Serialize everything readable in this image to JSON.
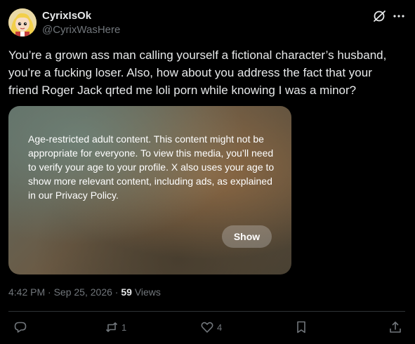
{
  "author": {
    "display_name": "CyrixIsOk",
    "handle": "@CyrixWasHere"
  },
  "tweet": {
    "text": "You’re a grown ass man calling yourself a fictional character’s husband, you’re a fucking loser. Also, how about you address the fact that your friend Roger Jack qrted me loli porn while knowing I was a minor?"
  },
  "media": {
    "warning": "Age-restricted adult content. This content might not be appropriate for everyone. To view this media, you’ll need to verify your age to your profile. X also uses your age to show more relevant content, including ads, as explained in our Privacy Policy.",
    "show_label": "Show"
  },
  "meta": {
    "time": "4:42 PM",
    "date": "Sep 25, 2026",
    "separator": " · ",
    "views_count": "59",
    "views_label": "Views"
  },
  "actions": {
    "reply_count": "",
    "repost_count": "1",
    "like_count": "4",
    "icons": [
      "reply-icon",
      "repost-icon",
      "like-icon",
      "bookmark-icon",
      "share-icon"
    ]
  },
  "colors": {
    "background": "#000000",
    "text": "#e7e9ea",
    "muted": "#71767b",
    "divider": "#2f3336"
  }
}
